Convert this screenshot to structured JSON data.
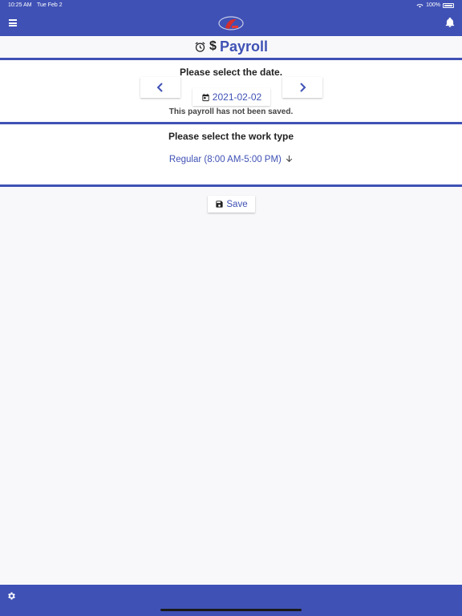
{
  "status_bar": {
    "time": "10:25 AM",
    "date": "Tue Feb 2",
    "battery": "100%"
  },
  "header": {
    "menu_icon": "menu-icon",
    "logo_icon": "app-logo",
    "notification_icon": "bell-icon"
  },
  "title": {
    "text": "Payroll",
    "alarm_icon": "alarm-clock-icon",
    "dollar": "$"
  },
  "date_section": {
    "label": "Please select the date.",
    "date_value": "2021-02-02",
    "status_note": "This payroll has not been saved.",
    "prev_icon": "chevron-left-icon",
    "next_icon": "chevron-right-icon",
    "calendar_icon": "calendar-icon"
  },
  "work_section": {
    "label": "Please select the work type",
    "selected": "Regular (8:00 AM-5:00 PM)",
    "dropdown_icon": "arrow-down-icon"
  },
  "save": {
    "label": "Save",
    "icon": "floppy-disk-icon"
  },
  "footer": {
    "settings_icon": "gear-icon"
  },
  "colors": {
    "primary": "#3f51b5",
    "background": "#f8f8fa",
    "surface": "#ffffff"
  }
}
